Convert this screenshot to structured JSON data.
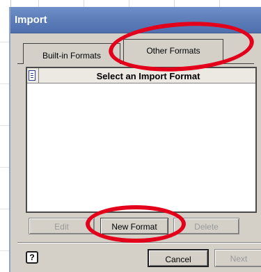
{
  "window": {
    "title": "Import"
  },
  "tabs": [
    {
      "label": "Built-in Formats",
      "active": false
    },
    {
      "label": "Other Formats",
      "active": true
    }
  ],
  "list": {
    "header": "Select an Import Format",
    "items": []
  },
  "format_buttons": {
    "edit": "Edit",
    "new_format": "New Format",
    "delete": "Delete"
  },
  "dialog_buttons": {
    "help": "?",
    "cancel": "Cancel",
    "next": "Next"
  },
  "colors": {
    "titlebar": "#5b7cb8",
    "dialog_bg": "#d4d0c8",
    "annotation": "#e3001b"
  },
  "icons": {
    "list_header": "column-chooser-icon",
    "help": "help-icon"
  }
}
